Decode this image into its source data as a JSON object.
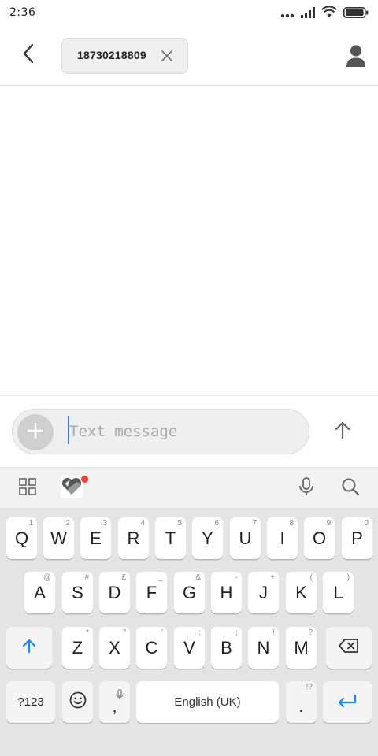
{
  "status_bar": {
    "time": "2:36"
  },
  "header": {
    "recipient": "18730218809",
    "back_icon": "chevron-left-icon",
    "contact_icon": "person-icon"
  },
  "compose": {
    "placeholder": "Text message",
    "attach_icon": "plus-icon",
    "send_icon": "arrow-up-icon"
  },
  "keyboard_toolbar": {
    "icons": [
      "grid-icon",
      "sticker-icon",
      "microphone-icon",
      "search-icon"
    ],
    "badge_color": "#f44336"
  },
  "keyboard": {
    "row1": [
      {
        "label": "Q",
        "hint": "1"
      },
      {
        "label": "W",
        "hint": "2"
      },
      {
        "label": "E",
        "hint": "3"
      },
      {
        "label": "R",
        "hint": "4"
      },
      {
        "label": "T",
        "hint": "5"
      },
      {
        "label": "Y",
        "hint": "6"
      },
      {
        "label": "U",
        "hint": "7"
      },
      {
        "label": "I",
        "hint": "8"
      },
      {
        "label": "O",
        "hint": "9"
      },
      {
        "label": "P",
        "hint": "0"
      }
    ],
    "row2": [
      {
        "label": "A",
        "hint": "@"
      },
      {
        "label": "S",
        "hint": "#"
      },
      {
        "label": "D",
        "hint": "£"
      },
      {
        "label": "F",
        "hint": "_"
      },
      {
        "label": "G",
        "hint": "&"
      },
      {
        "label": "H",
        "hint": "-"
      },
      {
        "label": "J",
        "hint": "+"
      },
      {
        "label": "K",
        "hint": "("
      },
      {
        "label": "L",
        "hint": ")"
      }
    ],
    "row3": [
      {
        "label": "Z",
        "hint": "*"
      },
      {
        "label": "X",
        "hint": "\""
      },
      {
        "label": "C",
        "hint": "'"
      },
      {
        "label": "V",
        "hint": ":"
      },
      {
        "label": "B",
        "hint": ";"
      },
      {
        "label": "N",
        "hint": "!"
      },
      {
        "label": "M",
        "hint": "?"
      }
    ],
    "symbols_label": "?123",
    "comma_label": ",",
    "space_label": "English (UK)",
    "period_label": ".",
    "period_hint": "!?",
    "accent_color": "#1e88e5"
  }
}
